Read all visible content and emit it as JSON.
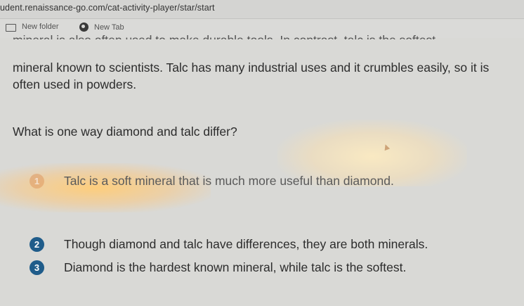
{
  "browser": {
    "url": "udent.renaissance-go.com/cat-activity-player/star/start",
    "bookmarks": [
      {
        "label": "New folder",
        "icon": "folder-icon"
      },
      {
        "label": "New Tab",
        "icon": "globe-icon"
      }
    ]
  },
  "passage": {
    "cut_line": "mineral is also often used to make durable tools. In contrast, talc is the softest",
    "text": "mineral known to scientists. Talc has many industrial uses and it crumbles easily, so it is often used in powders."
  },
  "question": "What is one way diamond and talc differ?",
  "options": [
    {
      "number": "1",
      "text": "Talc is a soft mineral that is much more useful than diamond."
    },
    {
      "number": "2",
      "text": "Though diamond and talc have differences, they are both minerals."
    },
    {
      "number": "3",
      "text": "Diamond is the hardest known mineral, while talc is the softest."
    }
  ],
  "colors": {
    "badge": "#1f5c8a",
    "background": "#d9d9d6"
  }
}
